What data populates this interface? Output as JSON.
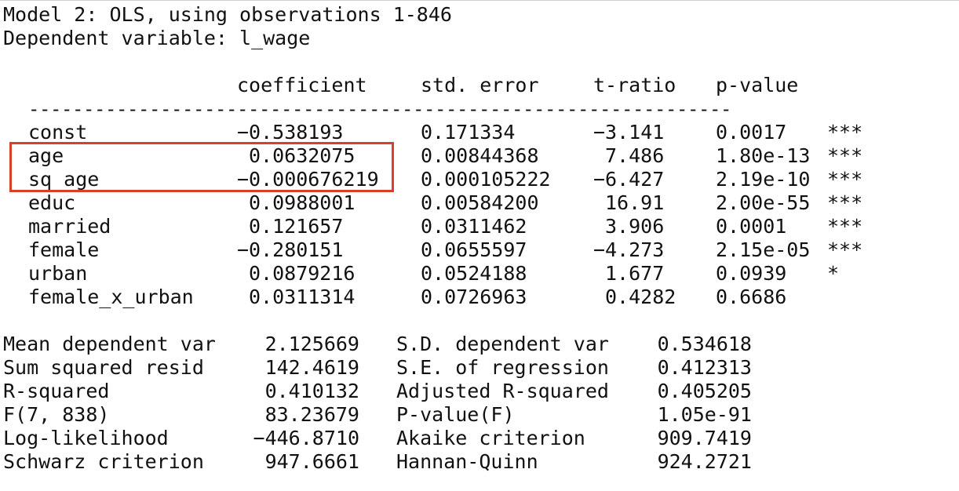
{
  "header": {
    "model_line": "Model 2: OLS, using observations 1-846",
    "depvar_line": "Dependent variable: l_wage"
  },
  "columns": {
    "coef": "coefficient",
    "se": "std. error",
    "t": "t-ratio",
    "p": "p-value"
  },
  "separator": "----------------------------------------------------------------",
  "rows": [
    {
      "name": "const",
      "coef": "−0.538193",
      "se": "0.171334",
      "t": "−3.141",
      "p": "0.0017",
      "stars": "***"
    },
    {
      "name": "age",
      "coef": "0.0632075",
      "se": "0.00844368",
      "t": "7.486",
      "p": "1.80e-13",
      "stars": "***"
    },
    {
      "name": "sq_age",
      "coef": "−0.000676219",
      "se": "0.000105222",
      "t": "−6.427",
      "p": "2.19e-10",
      "stars": "***"
    },
    {
      "name": "educ",
      "coef": "0.0988001",
      "se": "0.00584200",
      "t": "16.91",
      "p": "2.00e-55",
      "stars": "***"
    },
    {
      "name": "married",
      "coef": "0.121657",
      "se": "0.0311462",
      "t": "3.906",
      "p": "0.0001",
      "stars": "***"
    },
    {
      "name": "female",
      "coef": "−0.280151",
      "se": "0.0655597",
      "t": "−4.273",
      "p": "2.15e-05",
      "stars": "***"
    },
    {
      "name": "urban",
      "coef": "0.0879216",
      "se": "0.0524188",
      "t": "1.677",
      "p": "0.0939",
      "stars": "*"
    },
    {
      "name": "female_x_urban",
      "coef": "0.0311314",
      "se": "0.0726963",
      "t": "0.4282",
      "p": "0.6686",
      "stars": ""
    }
  ],
  "stats": [
    {
      "l_label": "Mean dependent var",
      "l_value": "2.125669",
      "r_label": "S.D. dependent var",
      "r_value": "0.534618"
    },
    {
      "l_label": "Sum squared resid",
      "l_value": "142.4619",
      "r_label": "S.E. of regression",
      "r_value": "0.412313"
    },
    {
      "l_label": "R-squared",
      "l_value": "0.410132",
      "r_label": "Adjusted R-squared",
      "r_value": "0.405205"
    },
    {
      "l_label": "F(7, 838)",
      "l_value": "83.23679",
      "r_label": "P-value(F)",
      "r_value": "1.05e-91"
    },
    {
      "l_label": "Log-likelihood",
      "l_value": "−446.8710",
      "r_label": "Akaike criterion",
      "r_value": "909.7419"
    },
    {
      "l_label": "Schwarz criterion",
      "l_value": "947.6661",
      "r_label": "Hannan-Quinn",
      "r_value": "924.2721"
    }
  ],
  "highlight": {
    "color": "#d9402b",
    "rows": [
      "age",
      "sq_age"
    ]
  }
}
